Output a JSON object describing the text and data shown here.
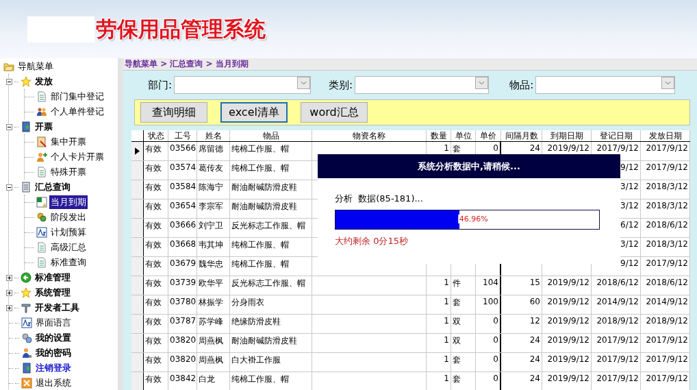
{
  "header": {
    "title": "劳保用品管理系统"
  },
  "nav": {
    "root": "导航菜单",
    "items": [
      {
        "label": "发放",
        "kind": "heading",
        "expanded": true,
        "selected": false,
        "children": [
          {
            "label": "部门集中登记",
            "selected": false
          },
          {
            "label": "个人单件登记",
            "selected": false
          }
        ]
      },
      {
        "label": "开票",
        "kind": "heading",
        "expanded": true,
        "selected": false,
        "children": [
          {
            "label": "集中开票",
            "selected": false
          },
          {
            "label": "个人卡片开票",
            "selected": false
          },
          {
            "label": "特殊开票",
            "selected": false
          }
        ]
      },
      {
        "label": "汇总查询",
        "kind": "heading",
        "expanded": true,
        "selected": false,
        "children": [
          {
            "label": "当月到期",
            "selected": true
          },
          {
            "label": "阶段发出",
            "selected": false
          },
          {
            "label": "计划预算",
            "selected": false
          },
          {
            "label": "高级汇总",
            "selected": false
          },
          {
            "label": "标准查询",
            "selected": false
          }
        ]
      },
      {
        "label": "标准管理",
        "kind": "heading",
        "expanded": false,
        "selected": false
      },
      {
        "label": "系统管理",
        "kind": "heading",
        "expanded": false,
        "selected": false
      },
      {
        "label": "开发者工具",
        "kind": "heading",
        "expanded": false,
        "selected": false
      },
      {
        "label": "界面语言",
        "kind": "plain",
        "selected": false
      },
      {
        "label": "我的设置",
        "kind": "heading",
        "selected": false
      },
      {
        "label": "我的密码",
        "kind": "heading",
        "selected": false
      },
      {
        "label": "注销登录",
        "kind": "link",
        "selected": false
      },
      {
        "label": "退出系统",
        "kind": "plain",
        "selected": false
      }
    ]
  },
  "breadcrumb": "导航菜单 > 汇总查询 > 当月到期",
  "filters": [
    {
      "label": "部门:"
    },
    {
      "label": "类别:"
    },
    {
      "label": "物品:"
    }
  ],
  "buttons": [
    {
      "label": "查询明细",
      "focused": false
    },
    {
      "label": "excel清单",
      "focused": true
    },
    {
      "label": "word汇总",
      "focused": false
    }
  ],
  "table": {
    "columns": [
      "状态",
      "工号",
      "姓名",
      "物品",
      "物资名称",
      "数量",
      "单位",
      "单价",
      "间隔月数",
      "到期日期",
      "登记日期",
      "发放日期"
    ],
    "rows": [
      {
        "current": true,
        "cells": [
          "有效",
          "03566",
          "席留德",
          "纯棉工作服、帽",
          null,
          "1",
          "套",
          "0",
          "24",
          "2019/9/12",
          "2017/9/12",
          "2017/9/12"
        ]
      },
      {
        "current": false,
        "cells": [
          "有效",
          "03574",
          "葛传友",
          "纯棉工作服、帽",
          null,
          null,
          null,
          null,
          null,
          null,
          "9/12",
          "2017/9/12"
        ]
      },
      {
        "current": false,
        "cells": [
          "有效",
          "03584",
          "陈海宁",
          "耐油耐碱防滑皮鞋",
          null,
          null,
          null,
          null,
          null,
          null,
          "3/12",
          "2018/3/12"
        ]
      },
      {
        "current": false,
        "cells": [
          "有效",
          "03654",
          "李宗军",
          "耐油耐碱防滑皮鞋",
          null,
          null,
          null,
          null,
          null,
          null,
          "3/12",
          "2018/3/12"
        ]
      },
      {
        "current": false,
        "cells": [
          "有效",
          "03666",
          "刘宁卫",
          "反光标志工作服、帽",
          null,
          null,
          null,
          null,
          null,
          null,
          "6/12",
          "2018/6/12"
        ]
      },
      {
        "current": false,
        "cells": [
          "有效",
          "03668",
          "韦其坤",
          "纯棉工作服、帽",
          null,
          null,
          null,
          null,
          null,
          null,
          "3/12",
          "2018/3/12"
        ]
      },
      {
        "current": false,
        "cells": [
          "有效",
          "03679",
          "魏华忠",
          "纯棉工作服、帽",
          null,
          null,
          null,
          null,
          null,
          null,
          "9/12",
          "2017/9/12"
        ]
      },
      {
        "current": false,
        "cells": [
          "有效",
          "03739",
          "欧华平",
          "反光标志工作服、帽",
          null,
          "1",
          "件",
          "104",
          "15",
          "2019/9/12",
          "2018/6/12",
          "2018/6/12"
        ]
      },
      {
        "current": false,
        "cells": [
          "有效",
          "03780",
          "林振学",
          "分身雨衣",
          null,
          "1",
          "套",
          "100",
          "60",
          "2019/9/12",
          "2014/9/12",
          "2014/9/12"
        ]
      },
      {
        "current": false,
        "cells": [
          "有效",
          "03787",
          "苏学峰",
          "绝缘防滑皮鞋",
          null,
          "1",
          "双",
          "0",
          "12",
          "2019/9/12",
          "2018/9/12",
          "2018/9/12"
        ]
      },
      {
        "current": false,
        "cells": [
          "有效",
          "03820",
          "周燕枫",
          "耐油耐碱防滑皮鞋",
          null,
          "1",
          "双",
          "0",
          "24",
          "2019/9/12",
          "2017/9/12",
          "2017/9/12"
        ]
      },
      {
        "current": false,
        "cells": [
          "有效",
          "03820",
          "周燕枫",
          "白大褂工作服",
          null,
          "1",
          "套",
          "0",
          "24",
          "2019/9/12",
          "2017/9/12",
          "2017/9/12"
        ]
      },
      {
        "current": false,
        "cells": [
          "有效",
          "03842",
          "白龙",
          "纯棉工作服、帽",
          null,
          "1",
          "套",
          "0",
          "24",
          "2019/9/12",
          "2017/9/12",
          "2017/9/12"
        ]
      }
    ]
  },
  "progress": {
    "title": "系统分析数据中,请稍候...",
    "status": "分析  数据(85-181)...",
    "level": 0.4696,
    "percent": "46.96%",
    "remaining": "大约剩余 0分15秒"
  }
}
